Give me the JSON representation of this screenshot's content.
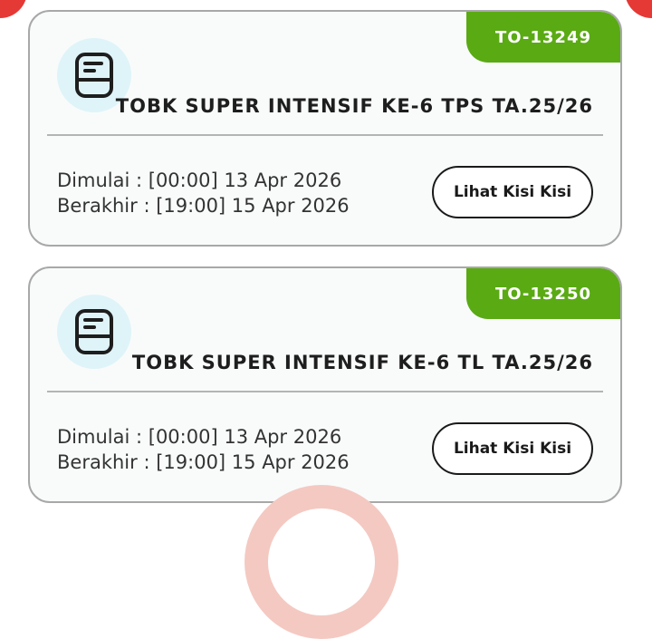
{
  "cards": [
    {
      "code": "TO-13249",
      "title": "TOBK SUPER INTENSIF KE-6 TPS TA.25/26",
      "start_label": "Dimulai :",
      "start_value": "[00:00] 13 Apr 2026",
      "end_label": "Berakhir :",
      "end_value": "[19:00] 15 Apr 2026",
      "button_label": "Lihat Kisi Kisi",
      "icon": "notebook-icon"
    },
    {
      "code": "TO-13250",
      "title": "TOBK SUPER INTENSIF KE-6 TL TA.25/26",
      "start_label": "Dimulai :",
      "start_value": "[00:00] 13 Apr 2026",
      "end_label": "Berakhir :",
      "end_value": "[19:00] 15 Apr 2026",
      "button_label": "Lihat Kisi Kisi",
      "icon": "notebook-icon"
    }
  ],
  "colors": {
    "badge": "#5aaa14",
    "accent_red": "#e53935",
    "icon_bg": "#dff4f8"
  }
}
